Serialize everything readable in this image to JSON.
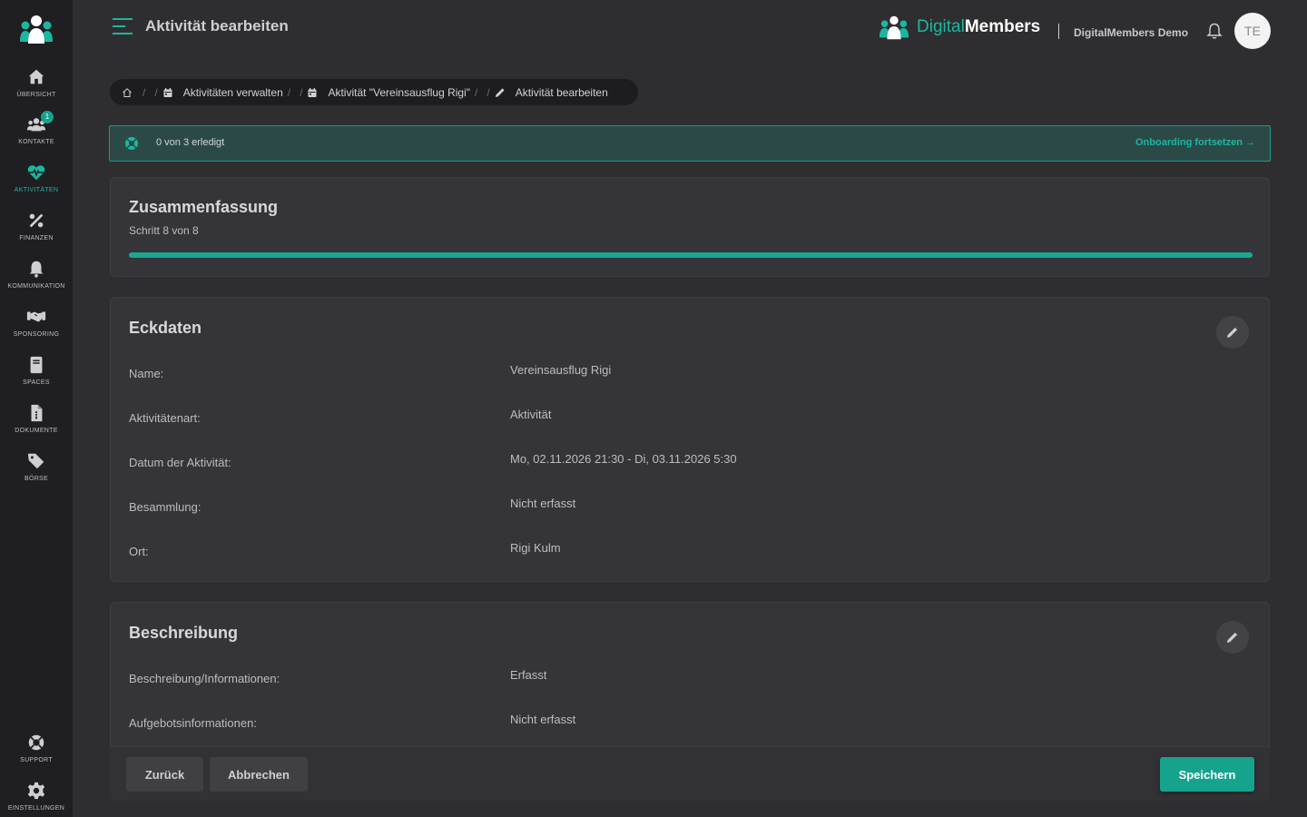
{
  "app": {
    "page_title": "Aktivität bearbeiten"
  },
  "brand": {
    "digital": "Digital",
    "members": "Members",
    "org_name": "DigitalMembers Demo",
    "accent": "#1cb7a0"
  },
  "user": {
    "initials": "TE"
  },
  "sidebar": {
    "items": [
      {
        "label": "ÜBERSICHT",
        "icon": "home-icon"
      },
      {
        "label": "KONTAKTE",
        "icon": "users-icon",
        "badge": "1"
      },
      {
        "label": "AKTIVITÄTEN",
        "icon": "heartbeat-icon",
        "active": true
      },
      {
        "label": "FINANZEN",
        "icon": "percent-icon"
      },
      {
        "label": "KOMMUNIKATION",
        "icon": "bell-icon"
      },
      {
        "label": "SPONSORING",
        "icon": "handshake-icon"
      },
      {
        "label": "SPACES",
        "icon": "book-icon"
      },
      {
        "label": "DOKUMENTE",
        "icon": "document-icon"
      },
      {
        "label": "BÖRSE",
        "icon": "tags-icon"
      }
    ],
    "bottom": [
      {
        "label": "SUPPORT",
        "icon": "lifering-icon"
      },
      {
        "label": "EINSTELLUNGEN",
        "icon": "gear-icon"
      }
    ]
  },
  "breadcrumb": {
    "items": [
      {
        "label": "Aktivitäten verwalten"
      },
      {
        "label": "Aktivität \"Vereinsausflug Rigi\""
      },
      {
        "label": "Aktivität bearbeiten"
      }
    ]
  },
  "onboarding": {
    "status": "0 von 3 erledigt",
    "link": "Onboarding fortsetzen"
  },
  "summary": {
    "title": "Zusammenfassung",
    "step": "Schritt 8 von 8",
    "progress": 1.0
  },
  "eckdaten": {
    "title": "Eckdaten",
    "rows": [
      {
        "label": "Name:",
        "value": "Vereinsausflug Rigi"
      },
      {
        "label": "Aktivitätenart:",
        "value": "Aktivität"
      },
      {
        "label": "Datum der Aktivität:",
        "value": "Mo, 02.11.2026 21:30 - Di, 03.11.2026 5:30"
      },
      {
        "label": "Besammlung:",
        "value": "Nicht erfasst"
      },
      {
        "label": "Ort:",
        "value": "Rigi Kulm"
      }
    ]
  },
  "beschreibung": {
    "title": "Beschreibung",
    "rows": [
      {
        "label": "Beschreibung/Informationen:",
        "value": "Erfasst"
      },
      {
        "label": "Aufgebotsinformationen:",
        "value": "Nicht erfasst"
      }
    ]
  },
  "actions": {
    "back": "Zurück",
    "cancel": "Abbrechen",
    "save": "Speichern"
  }
}
